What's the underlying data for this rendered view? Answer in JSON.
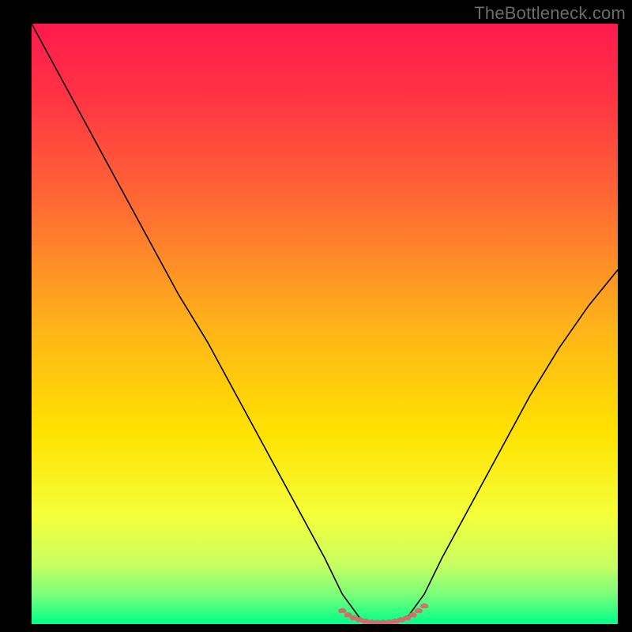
{
  "watermark": "TheBottleneck.com",
  "chart_data": {
    "type": "line",
    "title": "",
    "xlabel": "",
    "ylabel": "",
    "xlim": [
      0,
      100
    ],
    "ylim": [
      0,
      100
    ],
    "grid": false,
    "legend": {
      "visible": false
    },
    "background_gradient": {
      "orientation": "vertical",
      "stops": [
        {
          "pos": 0.0,
          "color": "#ff1a4d"
        },
        {
          "pos": 0.12,
          "color": "#ff3344"
        },
        {
          "pos": 0.3,
          "color": "#ff6a33"
        },
        {
          "pos": 0.5,
          "color": "#ffb21a"
        },
        {
          "pos": 0.68,
          "color": "#ffe200"
        },
        {
          "pos": 0.82,
          "color": "#f4ff3a"
        },
        {
          "pos": 0.9,
          "color": "#c8ff60"
        },
        {
          "pos": 0.95,
          "color": "#7bff7b"
        },
        {
          "pos": 1.0,
          "color": "#00ff88"
        }
      ]
    },
    "series": [
      {
        "name": "curve-left",
        "color": "#000000",
        "stroke_width": 1.6,
        "x": [
          0,
          5,
          10,
          15,
          20,
          25,
          30,
          35,
          40,
          45,
          50,
          53,
          56
        ],
        "y": [
          100,
          91,
          82,
          73,
          64,
          55,
          47,
          38,
          29,
          20,
          11,
          5,
          1
        ]
      },
      {
        "name": "curve-right",
        "color": "#000000",
        "stroke_width": 1.6,
        "x": [
          64,
          67,
          70,
          75,
          80,
          85,
          90,
          95,
          100
        ],
        "y": [
          1,
          5,
          11,
          20,
          29,
          38,
          46,
          53,
          59
        ]
      },
      {
        "name": "valley-dots",
        "type": "scatter",
        "color": "#d56a6a",
        "marker_size": 3.0,
        "x": [
          53,
          54,
          55,
          56,
          57,
          58,
          59,
          60,
          61,
          62,
          63,
          64,
          65,
          66,
          67
        ],
        "y": [
          2.3,
          1.6,
          1.1,
          0.8,
          0.55,
          0.4,
          0.35,
          0.35,
          0.4,
          0.55,
          0.8,
          1.1,
          1.6,
          2.3,
          3.1
        ]
      }
    ]
  }
}
